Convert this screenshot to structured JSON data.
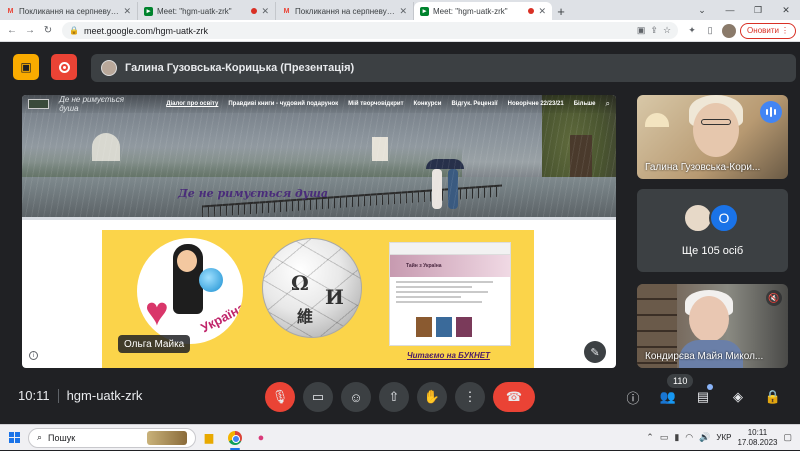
{
  "browser": {
    "tabs": [
      {
        "title": "Покликання на серпневу метод",
        "icon": "gmail-icon",
        "recording": false
      },
      {
        "title": "Meet: \"hgm-uatk-zrk\"",
        "icon": "meet-icon",
        "recording": true
      },
      {
        "title": "Покликання на серпневу метод",
        "icon": "gmail-icon",
        "recording": false
      },
      {
        "title": "Meet: \"hgm-uatk-zrk\"",
        "icon": "meet-icon",
        "recording": true,
        "active": true
      }
    ],
    "url": "meet.google.com/hgm-uatk-zrk",
    "update_label": "Оновити"
  },
  "meet": {
    "presenter_name": "Галина Гузовська-Корицька (Презентація)",
    "site": {
      "brand": "Де не римується душа",
      "nav": [
        "Діалог про освіту",
        "Правдиві книги - чудовий подарунок",
        "Мій творчовідкрит",
        "Конкурси",
        "Відгук. Рецензії",
        "Новорічне 22/23/21",
        "Більше"
      ],
      "motto": "Де не римується душа",
      "buket_caption": "Читаємо на БУКНЕТ",
      "logo1_text": "Україна",
      "wiki_letters": [
        "Ω",
        "И",
        "維"
      ],
      "screenshot_header": "Тайн з Україна"
    },
    "main_name_chip": "Ольга Майка",
    "tiles": [
      {
        "name": "Галина Гузовська-Кори...",
        "speaking": true
      },
      {
        "name": "Ще 105 осіб",
        "avatar_letter": "О"
      },
      {
        "name": "Кондирєва Майя Микол...",
        "muted": true
      }
    ],
    "time": "10:11",
    "meeting_code": "hgm-uatk-zrk",
    "participants_count": "110"
  },
  "taskbar": {
    "search_placeholder": "Пошук",
    "lang": "УКР",
    "time": "10:11",
    "date": "17.08.2023"
  },
  "colors": {
    "meet_bg": "#202124",
    "end_call": "#ea4335",
    "present_pill": "#f9ab00",
    "speaking": "#4285f4"
  }
}
